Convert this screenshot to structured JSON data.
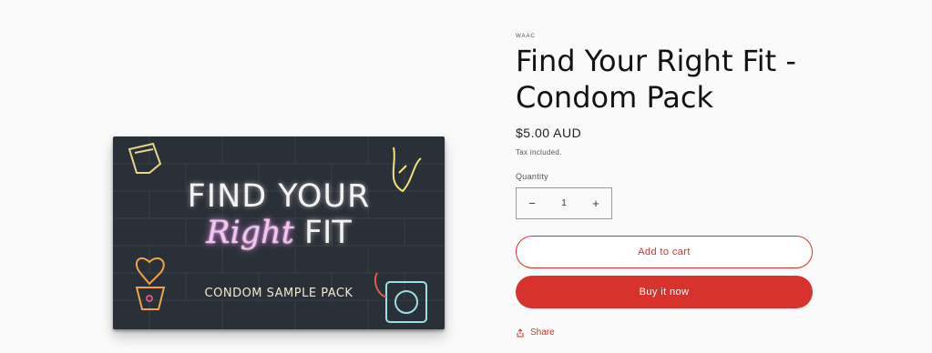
{
  "product": {
    "vendor": "WAAC",
    "title": "Find Your Right Fit - Condom Pack",
    "price": "$5.00 AUD",
    "tax_note": "Tax included.",
    "image": {
      "line1": "FIND YOUR",
      "line2_script": "Right",
      "line2_rest": " FIT",
      "subtitle": "CONDOM SAMPLE PACK"
    }
  },
  "quantity": {
    "label": "Quantity",
    "value": "1",
    "decrement": "−",
    "increment": "+"
  },
  "actions": {
    "add_to_cart": "Add to cart",
    "buy_now": "Buy it now",
    "share": "Share"
  },
  "colors": {
    "accent": "#d8322c",
    "box": "#2a3037"
  }
}
